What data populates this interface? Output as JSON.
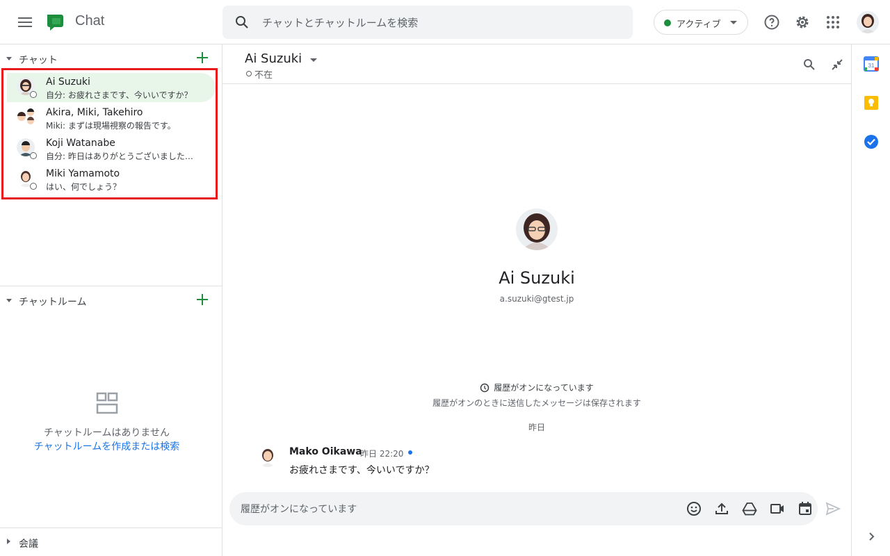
{
  "app": {
    "name": "Chat"
  },
  "search": {
    "placeholder": "チャットとチャットルームを検索"
  },
  "status": {
    "label": "アクティブ",
    "color": "#1e8e3e"
  },
  "sidebar": {
    "chats_header": "チャット",
    "chats": [
      {
        "name": "Ai Suzuki",
        "preview": "自分: お疲れさまです、今いいですか？",
        "active": true
      },
      {
        "name": "Akira, Miki, Takehiro",
        "preview": "Miki: まずは現場視察の報告です。",
        "active": false
      },
      {
        "name": "Koji Watanabe",
        "preview": "自分: 昨日はありがとうございました…",
        "active": false
      },
      {
        "name": "Miki Yamamoto",
        "preview": "はい、何でしょう？",
        "active": false
      }
    ],
    "rooms_header": "チャットルーム",
    "rooms_empty_text": "チャットルームはありません",
    "rooms_empty_link": "チャットルームを作成または検索",
    "meetings_header": "会議"
  },
  "conversation": {
    "title": "Ai Suzuki",
    "presence": "不在",
    "profile_name": "Ai Suzuki",
    "profile_email": "a.suzuki@gtest.jp",
    "history_on": "履歴がオンになっています",
    "history_sub": "履歴がオンのときに送信したメッセージは保存されます",
    "date_separator": "昨日",
    "messages": [
      {
        "sender": "Mako Oikawa",
        "time": "昨日 22:20",
        "text": "お疲れさまです、今いいですか？"
      }
    ],
    "composer_placeholder": "履歴がオンになっています"
  },
  "colors": {
    "accent_green": "#1e8e3e",
    "link_blue": "#1a73e8",
    "active_bg": "#e8f5e9",
    "highlight_red": "#e8191b"
  }
}
